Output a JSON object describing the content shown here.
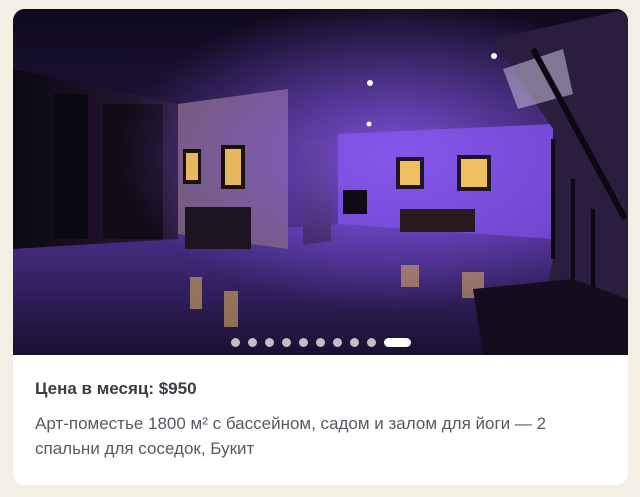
{
  "listing": {
    "price_label": "Цена в месяц: $950",
    "description": "Арт-поместье 1800 м² с бассейном, садом и залом для йоги — 2 спальни для соседок, Букит"
  },
  "carousel": {
    "slide_count": 10,
    "active_index": 9
  },
  "colors": {
    "page_background": "#f3efe4",
    "card_background": "#ffffff",
    "purple_light": "#7a45d8"
  },
  "icons": [
    "carousel-dot-icon"
  ]
}
